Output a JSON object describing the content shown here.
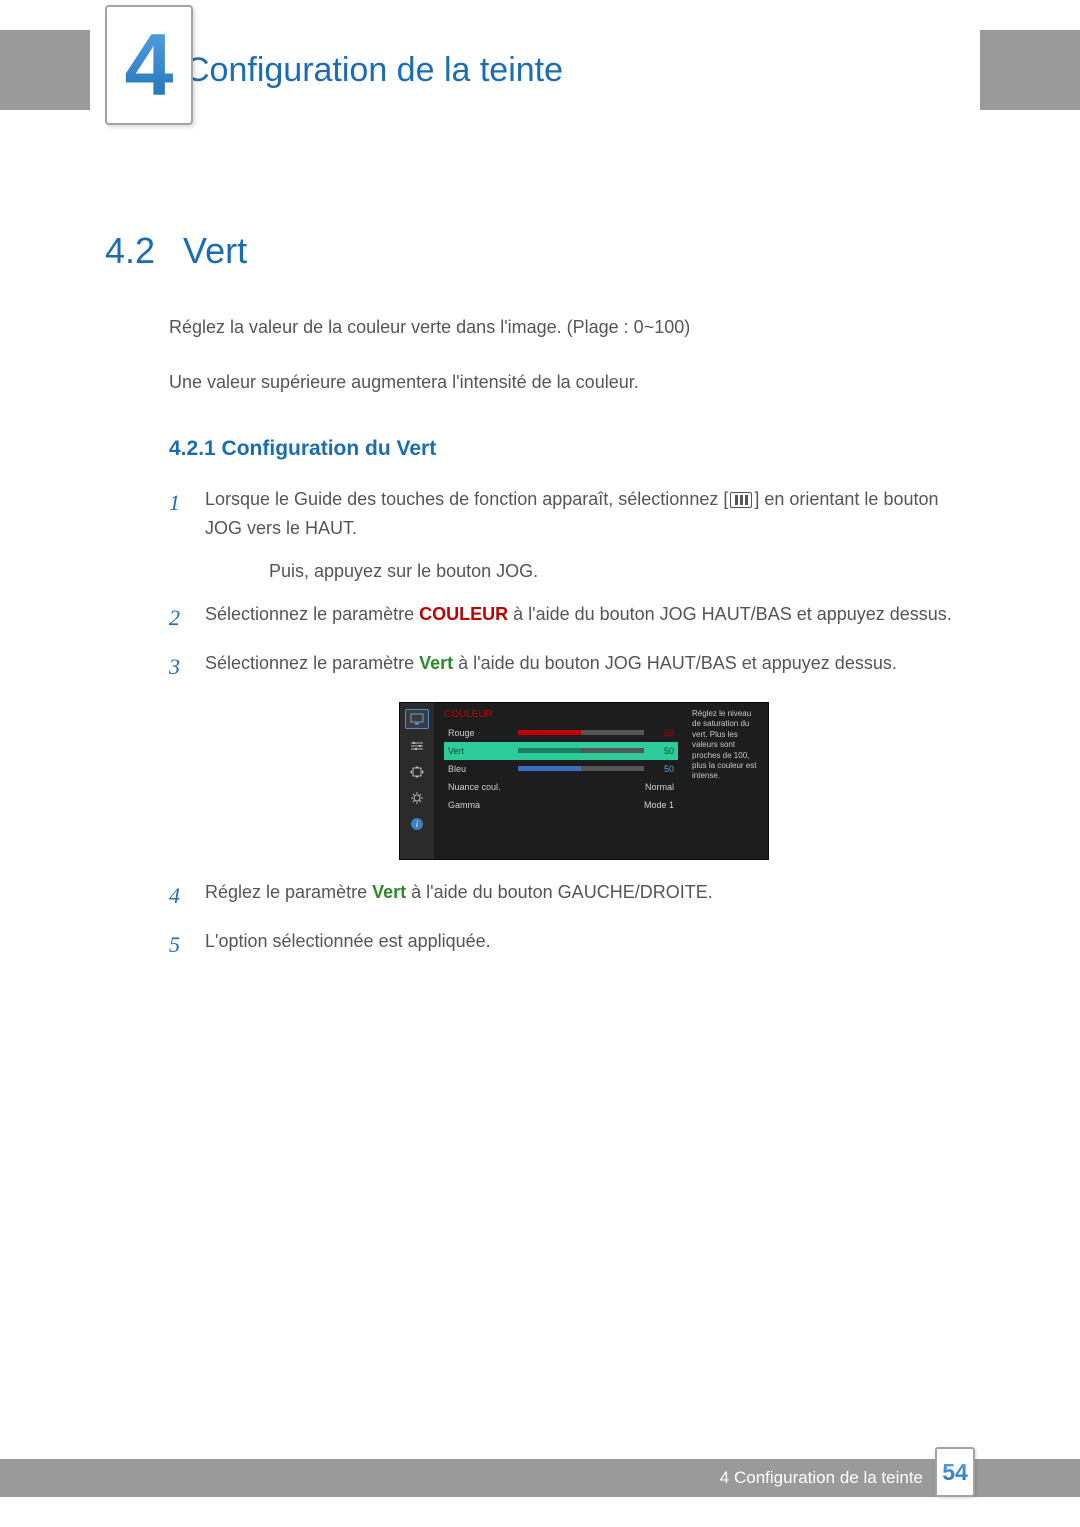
{
  "chapter": {
    "number": "4",
    "title": "Configuration de la teinte"
  },
  "section": {
    "number": "4.2",
    "title": "Vert"
  },
  "intro": {
    "p1": "Réglez la valeur de la couleur verte dans l'image. (Plage : 0~100)",
    "p2": "Une valeur supérieure augmentera l'intensité de la couleur."
  },
  "subsection": {
    "heading": "4.2.1   Configuration du Vert"
  },
  "steps": {
    "s1a": "Lorsque le Guide des touches de fonction apparaît, sélectionnez [",
    "s1b": "] en orientant le bouton JOG vers le HAUT.",
    "s1c": "Puis, appuyez sur le bouton JOG.",
    "s2a": "Sélectionnez le paramètre ",
    "s2_bold": "COULEUR",
    "s2b": " à l'aide du bouton JOG HAUT/BAS et appuyez dessus.",
    "s3a": "Sélectionnez le paramètre ",
    "s3_bold": "Vert",
    "s3b": " à l'aide du bouton JOG HAUT/BAS et appuyez dessus.",
    "s4a": "Réglez le paramètre ",
    "s4_bold": "Vert",
    "s4b": " à l'aide du bouton GAUCHE/DROITE.",
    "s5": "L'option sélectionnée est appliquée."
  },
  "step_nums": {
    "n1": "1",
    "n2": "2",
    "n3": "3",
    "n4": "4",
    "n5": "5"
  },
  "osd": {
    "title": "COULEUR",
    "rows": {
      "rouge": {
        "label": "Rouge",
        "value": "50",
        "fill": 50,
        "color": "#c00000"
      },
      "vert": {
        "label": "Vert",
        "value": "50",
        "fill": 50,
        "color": "#2ecc9b"
      },
      "bleu": {
        "label": "Bleu",
        "value": "50",
        "fill": 50,
        "color": "#3a6fc0"
      },
      "nuance": {
        "label": "Nuance coul.",
        "value": "Normal"
      },
      "gamma": {
        "label": "Gamma",
        "value": "Mode 1"
      }
    },
    "tooltip": "Réglez le niveau de saturation du vert. Plus les valeurs sont proches de 100, plus la couleur est intense."
  },
  "footer": {
    "text": "4 Configuration de la teinte",
    "page": "54"
  }
}
